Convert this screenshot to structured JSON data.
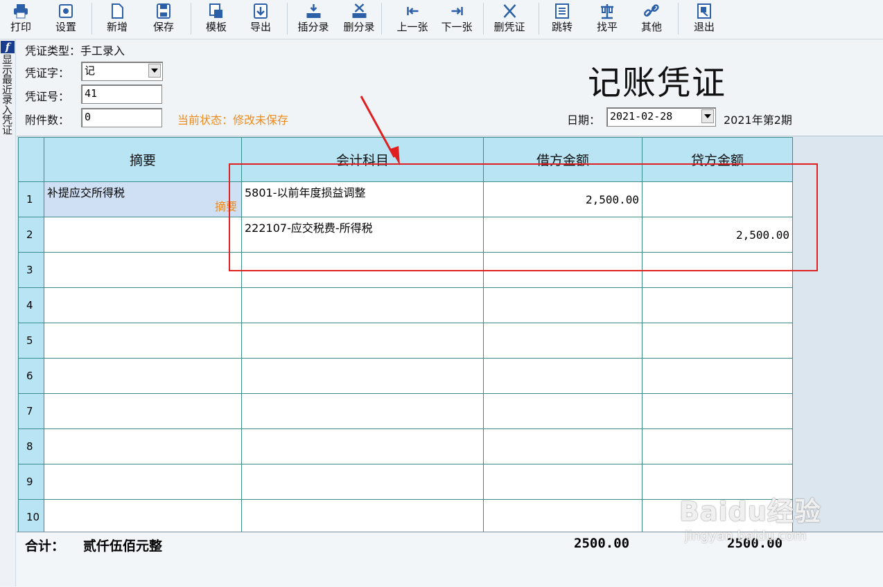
{
  "toolbar": {
    "buttons": [
      {
        "id": "print",
        "label": "打印",
        "icon": "printer-icon"
      },
      {
        "id": "settings",
        "label": "设置",
        "icon": "gear-icon"
      },
      {
        "id": "new",
        "label": "新增",
        "icon": "new-doc-icon"
      },
      {
        "id": "save",
        "label": "保存",
        "icon": "floppy-icon"
      },
      {
        "id": "template",
        "label": "模板",
        "icon": "template-icon"
      },
      {
        "id": "export",
        "label": "导出",
        "icon": "export-icon"
      },
      {
        "id": "insert_entry",
        "label": "插分录",
        "icon": "insert-row-icon"
      },
      {
        "id": "delete_entry",
        "label": "删分录",
        "icon": "delete-row-icon"
      },
      {
        "id": "prev",
        "label": "上一张",
        "icon": "prev-icon"
      },
      {
        "id": "next",
        "label": "下一张",
        "icon": "next-icon"
      },
      {
        "id": "delete_voucher",
        "label": "删凭证",
        "icon": "x-icon"
      },
      {
        "id": "jump",
        "label": "跳转",
        "icon": "jump-icon"
      },
      {
        "id": "balance",
        "label": "找平",
        "icon": "balance-icon"
      },
      {
        "id": "other",
        "label": "其他",
        "icon": "link-icon"
      },
      {
        "id": "exit",
        "label": "退出",
        "icon": "exit-icon"
      }
    ]
  },
  "side_strip": {
    "logo": "f",
    "text": "显示最近录入凭证"
  },
  "header": {
    "voucher_type_label": "凭证类型：",
    "voucher_type_value": "手工录入",
    "voucher_word_label": "凭证字：",
    "voucher_word_value": "记",
    "voucher_no_label": "凭证号：",
    "voucher_no_value": "41",
    "attachments_label": "附件数：",
    "attachments_value": "0",
    "status": "当前状态：修改未保存",
    "title": "记账凭证",
    "date_label": "日期：",
    "date_value": "2021-02-28",
    "period": "2021年第2期"
  },
  "grid": {
    "columns": [
      "摘要",
      "会计科目",
      "借方金额",
      "贷方金额"
    ],
    "rows": [
      {
        "no": "1",
        "summary": "补提应交所得税",
        "account": "5801-以前年度损益调整",
        "debit": "2,500.00",
        "credit": "",
        "tag": "摘要"
      },
      {
        "no": "2",
        "summary": "",
        "account": "222107-应交税费-所得税",
        "debit": "",
        "credit": "2,500.00"
      },
      {
        "no": "3",
        "summary": "",
        "account": "",
        "debit": "",
        "credit": ""
      },
      {
        "no": "4",
        "summary": "",
        "account": "",
        "debit": "",
        "credit": ""
      },
      {
        "no": "5",
        "summary": "",
        "account": "",
        "debit": "",
        "credit": ""
      },
      {
        "no": "6",
        "summary": "",
        "account": "",
        "debit": "",
        "credit": ""
      },
      {
        "no": "7",
        "summary": "",
        "account": "",
        "debit": "",
        "credit": ""
      },
      {
        "no": "8",
        "summary": "",
        "account": "",
        "debit": "",
        "credit": ""
      },
      {
        "no": "9",
        "summary": "",
        "account": "",
        "debit": "",
        "credit": ""
      },
      {
        "no": "10",
        "summary": "",
        "account": "",
        "debit": "",
        "credit": ""
      }
    ]
  },
  "footer": {
    "total_label": "合计：",
    "total_words": "贰仟伍佰元整",
    "debit_total": "2500.00",
    "credit_total": "2500.00"
  },
  "watermark": {
    "line1": "Baidu经验",
    "line2": "jingyan.baidu.com"
  },
  "colors": {
    "header_bg": "#b8e4f4",
    "grid_line": "#3a8c8c",
    "status": "#f08a1c",
    "annotation": "#e02020",
    "selected_cell": "#cfe0f5"
  }
}
